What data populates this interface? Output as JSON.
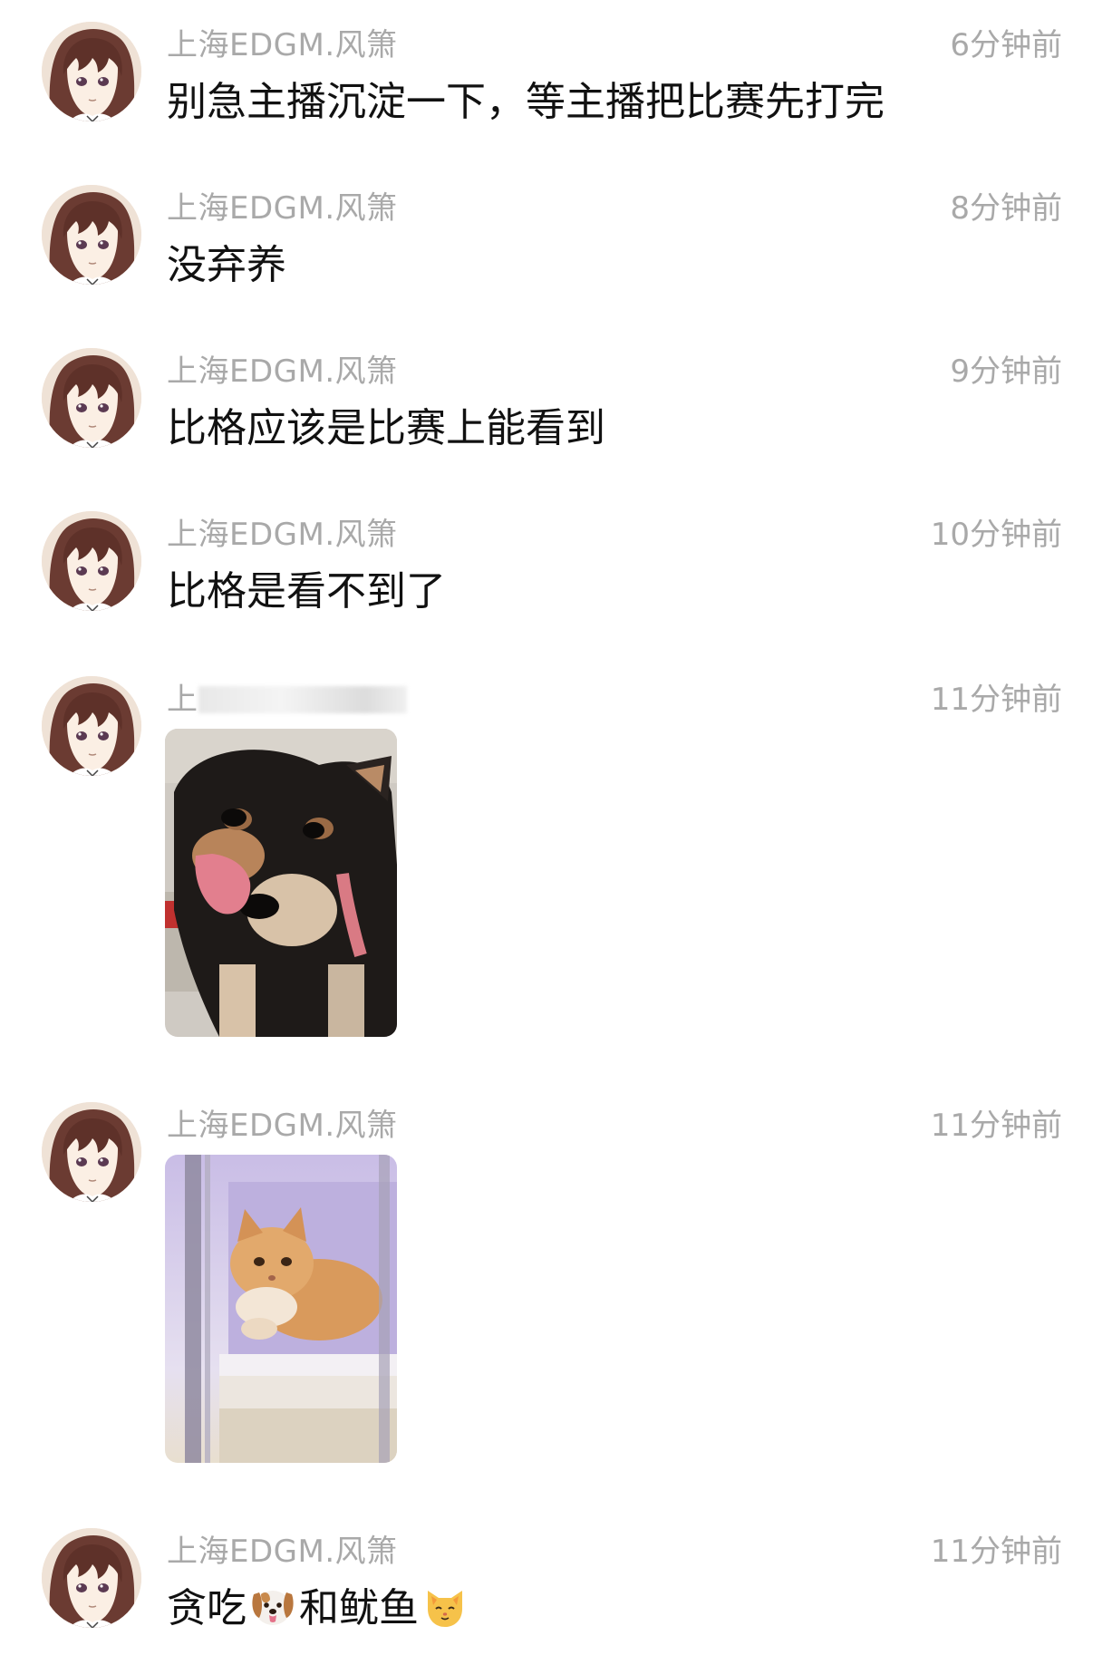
{
  "messages": [
    {
      "name": "上海EDGM.风箫",
      "time": "6分钟前",
      "text": "别急主播沉淀一下，等主播把比赛先打完"
    },
    {
      "name": "上海EDGM.风箫",
      "time": "8分钟前",
      "text": "没弃养"
    },
    {
      "name": "上海EDGM.风箫",
      "time": "9分钟前",
      "text": "比格应该是比赛上能看到"
    },
    {
      "name": "上海EDGM.风箫",
      "time": "10分钟前",
      "text": "比格是看不到了"
    },
    {
      "name": "上",
      "time": "11分钟前",
      "image": "dog-photo"
    },
    {
      "name": "上海EDGM.风箫",
      "time": "11分钟前",
      "image": "cat-photo"
    },
    {
      "name": "上海EDGM.风箫",
      "time": "11分钟前",
      "text_parts": [
        "贪吃",
        "和鱿鱼"
      ],
      "emojis": [
        "dog-face-emoji",
        "cat-face-emoji"
      ]
    }
  ]
}
